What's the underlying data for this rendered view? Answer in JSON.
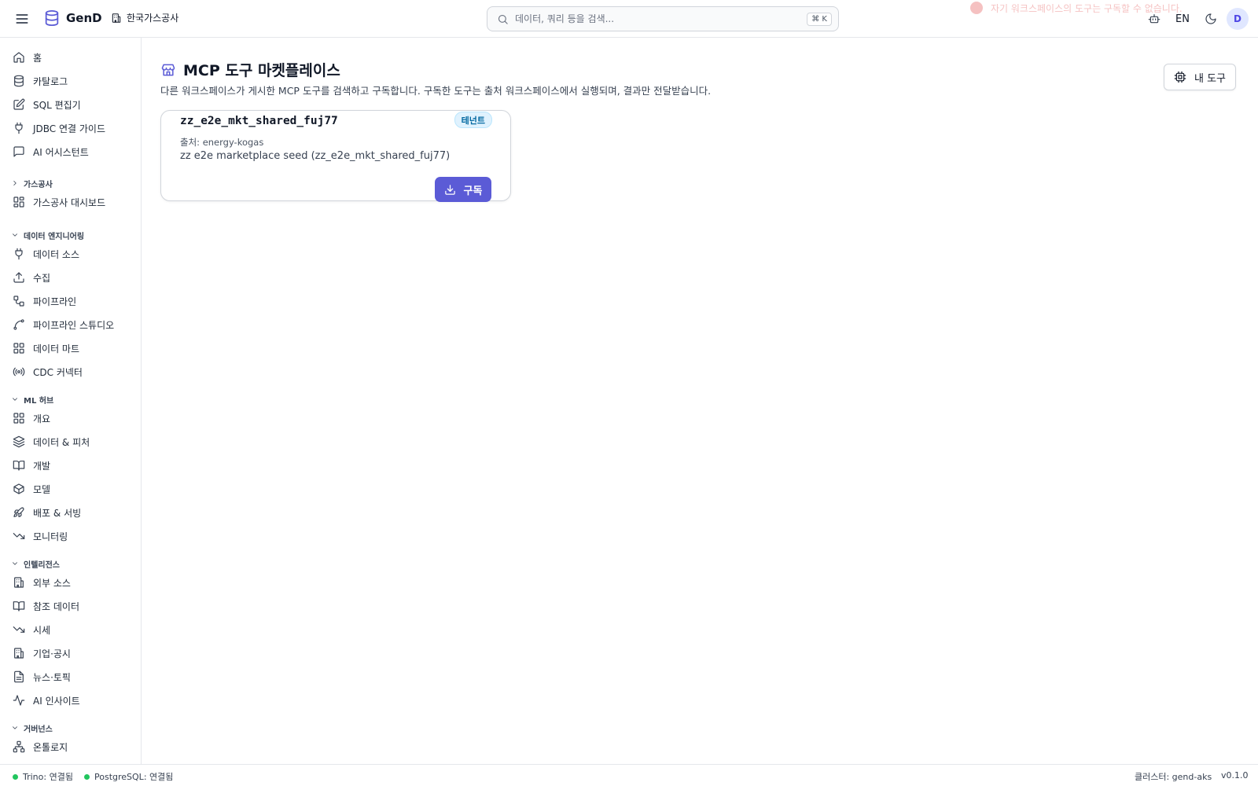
{
  "app": {
    "brand": "GenD",
    "workspace": "한국가스공사"
  },
  "search": {
    "placeholder": "데이터, 쿼리 등을 검색...",
    "shortcut": "⌘ K"
  },
  "toast": {
    "text": "자기 워크스페이스의 도구는 구독할 수 없습니다."
  },
  "header": {
    "lang": "EN",
    "avatar_initial": "D"
  },
  "sidebar": {
    "top_items": [
      {
        "label": "홈",
        "icon": "home-icon"
      },
      {
        "label": "카탈로그",
        "icon": "database-icon"
      },
      {
        "label": "SQL 편집기",
        "icon": "edit-icon"
      },
      {
        "label": "JDBC 연결 가이드",
        "icon": "plug-icon"
      },
      {
        "label": "AI 어시스턴트",
        "icon": "chat-icon"
      }
    ],
    "sections": [
      {
        "title": "가스공사",
        "collapsed": true,
        "items": [
          {
            "label": "가스공사 대시보드",
            "icon": "dashboard-icon"
          }
        ]
      },
      {
        "title": "데이터 엔지니어링",
        "collapsed": false,
        "items": [
          {
            "label": "데이터 소스",
            "icon": "plug-icon"
          },
          {
            "label": "수집",
            "icon": "upload-icon"
          },
          {
            "label": "파이프라인",
            "icon": "workflow-icon"
          },
          {
            "label": "파이프라인 스튜디오",
            "icon": "spline-icon"
          },
          {
            "label": "데이터 마트",
            "icon": "grid-icon"
          },
          {
            "label": "CDC 커넥터",
            "icon": "radio-icon"
          }
        ]
      },
      {
        "title": "ML 허브",
        "collapsed": false,
        "items": [
          {
            "label": "개요",
            "icon": "grid-icon"
          },
          {
            "label": "데이터 & 피처",
            "icon": "layers-icon"
          },
          {
            "label": "개발",
            "icon": "book-icon"
          },
          {
            "label": "모델",
            "icon": "box-icon"
          },
          {
            "label": "배포 & 서빙",
            "icon": "rocket-icon"
          },
          {
            "label": "모니터링",
            "icon": "trend-down-icon"
          }
        ]
      },
      {
        "title": "인텔리전스",
        "collapsed": false,
        "items": [
          {
            "label": "외부 소스",
            "icon": "building-icon"
          },
          {
            "label": "참조 데이터",
            "icon": "book-icon"
          },
          {
            "label": "시세",
            "icon": "trend-down-icon"
          },
          {
            "label": "기업·공시",
            "icon": "building-icon"
          },
          {
            "label": "뉴스·토픽",
            "icon": "file-icon"
          },
          {
            "label": "AI 인사이트",
            "icon": "activity-icon"
          }
        ]
      },
      {
        "title": "거버넌스",
        "collapsed": false,
        "items": [
          {
            "label": "온톨로지",
            "icon": "network-icon"
          }
        ]
      }
    ]
  },
  "main": {
    "title": "MCP 도구 마켓플레이스",
    "description": "다른 워크스페이스가 게시한 MCP 도구를 검색하고 구독합니다. 구독한 도구는 출처 워크스페이스에서 실행되며, 결과만 전달받습니다.",
    "my_tools_label": "내 도구",
    "cards": [
      {
        "name": "zz_e2e_mkt_shared_fuj77",
        "badge": "테넌트",
        "source": "출처: energy-kogas",
        "description": "zz e2e marketplace seed (zz_e2e_mkt_shared_fuj77)",
        "action_label": "구독"
      }
    ]
  },
  "statusbar": {
    "trino": "Trino: 연결됨",
    "postgres": "PostgreSQL: 연결됨",
    "cluster": "클러스터: gend-aks",
    "version": "v0.1.0"
  },
  "colors": {
    "accent": "#5b5bd6",
    "badge_bg": "#e0f2fe",
    "status_ok": "#22c55e"
  }
}
